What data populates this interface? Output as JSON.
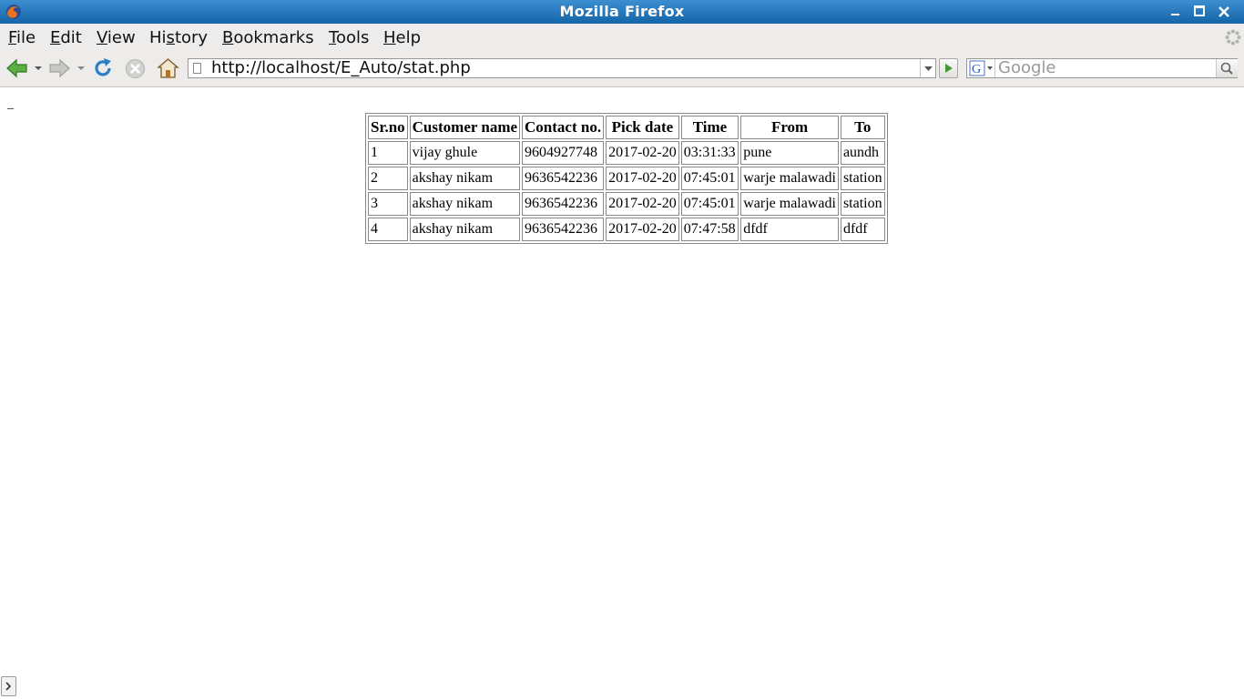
{
  "window": {
    "title": "Mozilla Firefox"
  },
  "menu": {
    "items": [
      {
        "pre": "",
        "u": "F",
        "post": "ile"
      },
      {
        "pre": "",
        "u": "E",
        "post": "dit"
      },
      {
        "pre": "",
        "u": "V",
        "post": "iew"
      },
      {
        "pre": "Hi",
        "u": "s",
        "post": "tory"
      },
      {
        "pre": "",
        "u": "B",
        "post": "ookmarks"
      },
      {
        "pre": "",
        "u": "T",
        "post": "ools"
      },
      {
        "pre": "",
        "u": "H",
        "post": "elp"
      }
    ]
  },
  "navbar": {
    "url": "http://localhost/E_Auto/stat.php",
    "search_placeholder": "Google",
    "icons": {
      "back": "back-arrow-icon",
      "forward": "forward-arrow-icon",
      "reload": "reload-icon",
      "stop": "stop-icon",
      "home": "home-icon"
    }
  },
  "page": {
    "mark": "_",
    "table": {
      "headers": [
        "Sr.no",
        "Customer name",
        "Contact no.",
        "Pick date",
        "Time",
        "From",
        "To"
      ],
      "rows": [
        [
          "1",
          "vijay ghule",
          "9604927748",
          "2017-02-20",
          "03:31:33",
          "pune",
          "aundh"
        ],
        [
          "2",
          "akshay nikam",
          "9636542236",
          "2017-02-20",
          "07:45:01",
          "warje malawadi",
          "station"
        ],
        [
          "3",
          "akshay nikam",
          "9636542236",
          "2017-02-20",
          "07:45:01",
          "warje malawadi",
          "station"
        ],
        [
          "4",
          "akshay nikam",
          "9636542236",
          "2017-02-20",
          "07:47:58",
          "dfdf",
          "dfdf"
        ]
      ]
    }
  },
  "colors": {
    "titlebar": "#1c6fb6",
    "chrome": "#edeceb",
    "nav_green": "#3f9b32"
  }
}
